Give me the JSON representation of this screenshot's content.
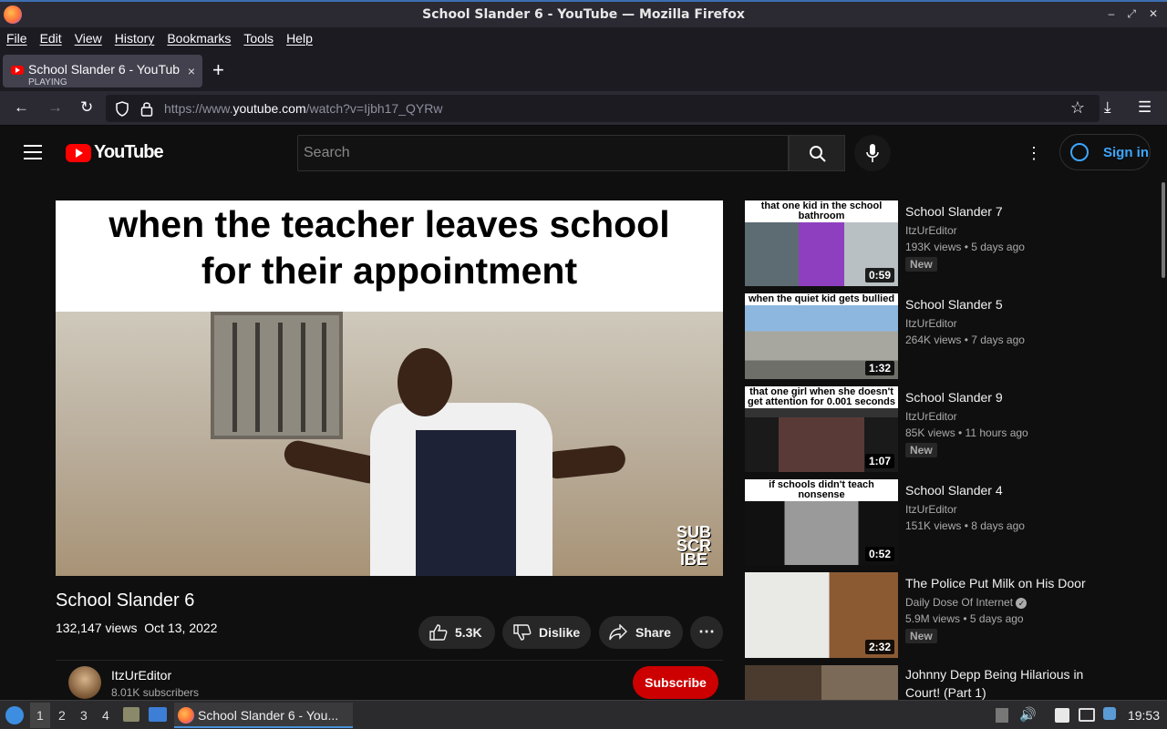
{
  "window": {
    "title": "School Slander 6 - YouTube — Mozilla Firefox"
  },
  "menu": [
    "File",
    "Edit",
    "View",
    "History",
    "Bookmarks",
    "Tools",
    "Help"
  ],
  "tab": {
    "title": "School Slander 6 - YouTube",
    "status": "PLAYING",
    "close": "×",
    "new_tab": "+"
  },
  "nav": {
    "url_prefix": "https://www.",
    "url_domain": "youtube.com",
    "url_rest": "/watch?v=Ijbh17_QYRw"
  },
  "yt": {
    "logo_text": "YouTube",
    "search_placeholder": "Search",
    "sign_in": "Sign in",
    "brand_color": "#ff0000"
  },
  "video": {
    "caption_line1": "when the teacher leaves school",
    "caption_line2": "for their appointment",
    "watermark": "SUB SCR IBE",
    "title": "School Slander 6",
    "views": "132,147 views",
    "date": "Oct 13, 2022",
    "likes": "5.3K",
    "dislike": "Dislike",
    "share": "Share",
    "channel": "ItzUrEditor",
    "subscribers": "8.01K subscribers",
    "subscribe": "Subscribe"
  },
  "recommended": [
    {
      "caption": "that one kid in the school bathroom",
      "duration": "0:59",
      "title": "School Slander 7",
      "channel": "ItzUrEditor",
      "meta": "193K views • 5 days ago",
      "badge": "New",
      "thumb": "#8e3fbf"
    },
    {
      "caption": "when the quiet kid gets bullied",
      "duration": "1:32",
      "title": "School Slander 5",
      "channel": "ItzUrEditor",
      "meta": "264K views • 7 days ago",
      "badge": "",
      "thumb": "#7aa7d6"
    },
    {
      "caption": "that one girl when she doesn't get attention for 0.001 seconds",
      "duration": "1:07",
      "title": "School Slander 9",
      "channel": "ItzUrEditor",
      "meta": "85K views • 11 hours ago",
      "badge": "New",
      "thumb": "#4a2f2f"
    },
    {
      "caption": "if schools didn't teach nonsense",
      "duration": "0:52",
      "title": "School Slander 4",
      "channel": "ItzUrEditor",
      "meta": "151K views • 8 days ago",
      "badge": "",
      "thumb": "#8a8a8a"
    },
    {
      "caption": "",
      "duration": "2:32",
      "title": "The Police Put Milk on His Door",
      "channel": "Daily Dose Of Internet",
      "meta": "5.9M views • 5 days ago",
      "badge": "New",
      "thumb": "#b07a4c"
    },
    {
      "caption": "",
      "duration": "",
      "title": "Johnny Depp Being Hilarious in Court! (Part 1)",
      "channel": "",
      "meta": "",
      "badge": "",
      "thumb": "#6b5a4a"
    }
  ],
  "taskbar": {
    "workspaces": [
      "1",
      "2",
      "3",
      "4"
    ],
    "task_title": "School Slander 6 - You...",
    "clock": "19:53"
  }
}
